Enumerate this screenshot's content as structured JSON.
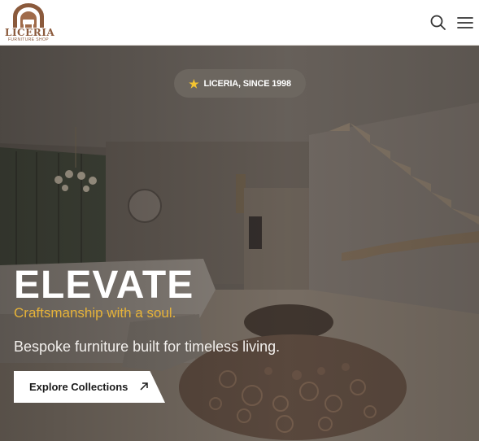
{
  "header": {
    "logo_text": "LICERIA",
    "logo_subtext": "FURNITURE SHOP",
    "search_icon": "search-icon",
    "menu_icon": "hamburger-menu-icon"
  },
  "hero": {
    "badge": {
      "icon": "star-icon",
      "text": "LICERIA, SINCE 1998"
    },
    "headline": "ELEVATE",
    "tagline": "Craftsmanship with a soul.",
    "description": "Bespoke furniture built for timeless living.",
    "cta_label": "Explore Collections",
    "cta_icon": "arrow-up-right-icon"
  },
  "colors": {
    "brand": "#8b5a3c",
    "accent": "#e7b338",
    "badge_star": "#f4c430"
  }
}
